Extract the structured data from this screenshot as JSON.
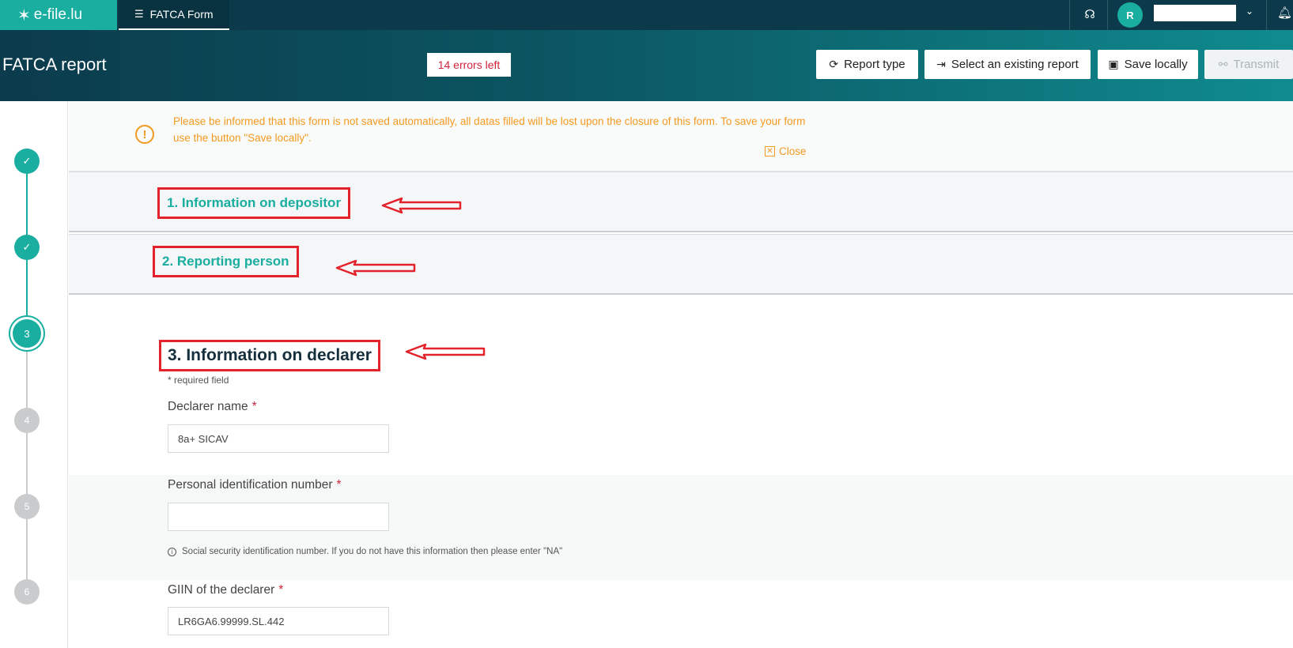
{
  "topbar": {
    "logo_text": "e-file.lu",
    "tab_label": "FATCA Form",
    "avatar_initial": "R"
  },
  "header": {
    "title": "FATCA report",
    "errors_badge": "14 errors left",
    "buttons": {
      "report_type": "Report type",
      "select_existing": "Select an existing report",
      "save_locally": "Save locally",
      "transmit": "Transmit"
    }
  },
  "stepper": {
    "steps": [
      {
        "label": "",
        "state": "done"
      },
      {
        "label": "",
        "state": "done"
      },
      {
        "label": "3",
        "state": "current"
      },
      {
        "label": "4",
        "state": "todo"
      },
      {
        "label": "5",
        "state": "todo"
      },
      {
        "label": "6",
        "state": "todo"
      }
    ]
  },
  "notice": {
    "text": "Please be informed that this form is not saved automatically, all datas filled will be lost upon the closure of this form. To save your form use the button \"Save locally\".",
    "close_label": "Close"
  },
  "sections": {
    "s1": "1. Information on depositor",
    "s2": "2. Reporting person"
  },
  "form": {
    "title": "3. Information on declarer",
    "required_note": "* required field",
    "fields": {
      "declarer_name": {
        "label": "Declarer name",
        "value": "8a+ SICAV"
      },
      "pin": {
        "label": "Personal identification number",
        "value": "",
        "hint": "Social security identification number. If you do not have this information then please enter \"NA\""
      },
      "giin": {
        "label": "GIIN of the declarer",
        "value": "LR6GA6.99999.SL.442"
      }
    },
    "required_marker": "*"
  },
  "colors": {
    "teal": "#1aaea1",
    "navy": "#0c3a4a",
    "warning": "#f29a1f",
    "error": "#d0243a",
    "annotation_red": "#e3222b"
  }
}
